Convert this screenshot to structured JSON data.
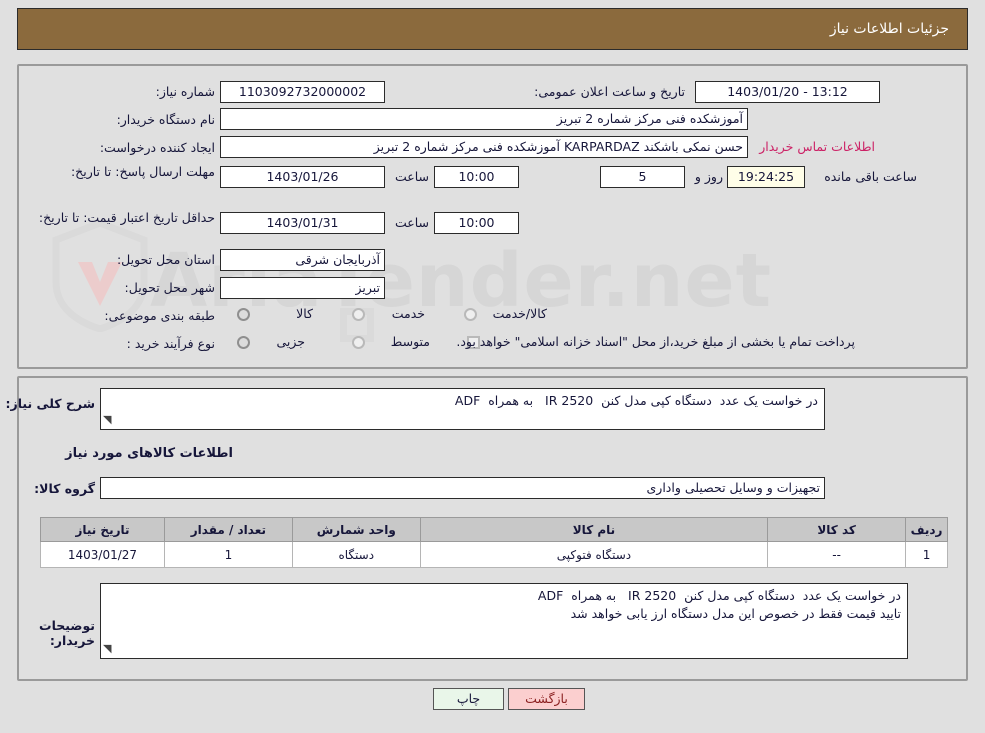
{
  "header": {
    "title": "جزئیات اطلاعات نیاز"
  },
  "form": {
    "need_number_label": "شماره نیاز:",
    "need_number_value": "1103092732000002",
    "announce_label": "تاریخ و ساعت اعلان عمومی:",
    "announce_value": "13:12 - 1403/01/20",
    "buyer_org_label": "نام دستگاه خریدار:",
    "buyer_org_value": "آموزشکده فنی مرکز شماره 2 تبریز",
    "creator_label": "ایجاد کننده درخواست:",
    "creator_value": "حسن نمکی باشکند KARPARDAZ آموزشکده فنی مرکز شماره 2 تبریز",
    "contact_link": "اطلاعات تماس خریدار",
    "deadline_label": "مهلت ارسال پاسخ: تا تاریخ:",
    "deadline_date": "1403/01/26",
    "deadline_hour_label": "ساعت",
    "deadline_hour": "10:00",
    "remain_days": "5",
    "remain_days_label": "روز و",
    "remain_time": "19:24:25",
    "remain_suffix": "ساعت باقی مانده",
    "validity_label": "حداقل تاریخ اعتبار قیمت: تا تاریخ:",
    "validity_date": "1403/01/31",
    "validity_hour_label": "ساعت",
    "validity_hour": "10:00",
    "province_label": "استان محل تحویل:",
    "province_value": "آذربایجان شرقی",
    "city_label": "شهر محل تحویل:",
    "city_value": "تبریز",
    "category_label": "طبقه بندی موضوعی:",
    "category_options": [
      "کالا",
      "خدمت",
      "کالا/خدمت"
    ],
    "process_label": "نوع فرآیند خرید :",
    "process_options": [
      "جزیی",
      "متوسط"
    ],
    "treasury_note": "پرداخت تمام یا بخشی از مبلغ خرید،از محل \"اسناد خزانه اسلامی\" خواهد بود."
  },
  "description": {
    "label": "شرح کلی نیاز:",
    "value": "در خواست یک عدد  دستگاه کپی مدل کنن  IR 2520   به همراه  ADF"
  },
  "goods": {
    "section_title": "اطلاعات کالاهای مورد نیاز",
    "group_label": "گروه کالا:",
    "group_value": "تجهیزات و وسایل تحصیلی واداری",
    "columns": [
      "ردیف",
      "کد کالا",
      "نام کالا",
      "واحد شمارش",
      "تعداد / مقدار",
      "تاریخ نیاز"
    ],
    "rows": [
      [
        "1",
        "--",
        "دستگاه فتوکپی",
        "دستگاه",
        "1",
        "1403/01/27"
      ]
    ]
  },
  "buyer_notes": {
    "label": "توضیحات خریدار:",
    "line1": "در خواست یک عدد  دستگاه کپی مدل کنن  IR 2520   به همراه  ADF",
    "line2": "تایید قیمت فقط در خصوص این مدل دستگاه ارز یابی خواهد شد"
  },
  "buttons": {
    "print": "چاپ",
    "back": "بازگشت"
  },
  "watermark": {
    "text": "AriaTender.net"
  },
  "colors": {
    "header_brown": "#8b6a3d",
    "page_bg": "#e0e0e0",
    "link_pink": "#cc2266",
    "highlight_cream": "#fffee8",
    "table_header": "#c8c8c8",
    "btn_print": "#e9f6e9",
    "btn_back": "#fbcfcf"
  }
}
